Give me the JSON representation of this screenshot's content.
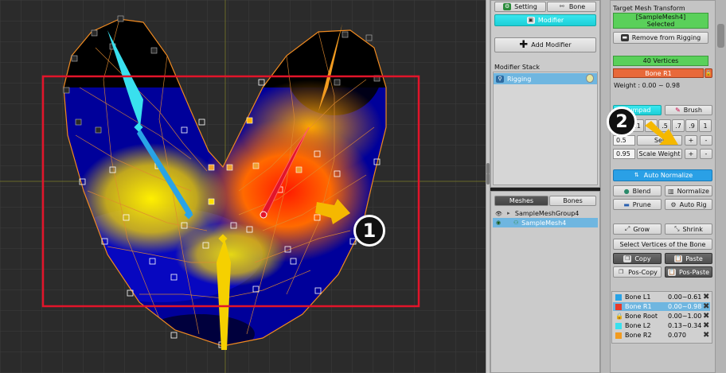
{
  "viewport": {
    "marker1": "1",
    "marker2": "2"
  },
  "top_tabs": {
    "setting": "Setting",
    "bone": "Bone",
    "modifier": "Modifier",
    "add_modifier": "Add Modifier"
  },
  "modifier_stack": {
    "title": "Modifier Stack",
    "items": [
      {
        "label": "Rigging"
      }
    ]
  },
  "list_tabs": {
    "meshes": "Meshes",
    "bones": "Bones"
  },
  "tree": {
    "group": "SampleMeshGroup4",
    "mesh": "SampleMesh4"
  },
  "target": {
    "title": "Target Mesh Transform",
    "selected_name": "[SampleMesh4]",
    "selected_status": "Selected",
    "remove_btn": "Remove from Rigging",
    "vertices": "40 Vertices",
    "bone": "Bone R1",
    "weight": "Weight : 0.00 ~ 0.98"
  },
  "tools": {
    "numpad": "Numpad",
    "brush": "Brush",
    "numbers": [
      "0",
      ".1",
      ".3",
      ".5",
      ".7",
      ".9",
      "1"
    ],
    "set_value": "0.5",
    "set_btn": "Set",
    "scale_value": "0.95",
    "scale_btn": "Scale Weight",
    "plus": "+",
    "minus": "-",
    "auto_normalize": "Auto Normalize",
    "blend": "Blend",
    "normalize": "Normalize",
    "prune": "Prune",
    "auto_rig": "Auto Rig",
    "grow": "Grow",
    "shrink": "Shrink",
    "select_vertices": "Select Vertices of the Bone",
    "copy": "Copy",
    "paste": "Paste",
    "pos_copy": "Pos-Copy",
    "pos_paste": "Pos-Paste"
  },
  "bone_weights": [
    {
      "name": "Bone L1",
      "range": "0.00~0.61",
      "color": "#29a3e6"
    },
    {
      "name": "Bone R1",
      "range": "0.00~0.98",
      "color": "#e83a2a"
    },
    {
      "name": "Bone Root",
      "range": "0.00~1.00",
      "color": "#8a2a2a"
    },
    {
      "name": "Bone L2",
      "range": "0.13~0.34",
      "color": "#39e0ee"
    },
    {
      "name": "Bone R2",
      "range": "0.070",
      "color": "#f29b20"
    }
  ],
  "colors": {
    "accent": "#1ccfd8",
    "highlight": "#e2142a",
    "arrow": "#f5b800",
    "selected_bg": "#6fb6e0"
  }
}
